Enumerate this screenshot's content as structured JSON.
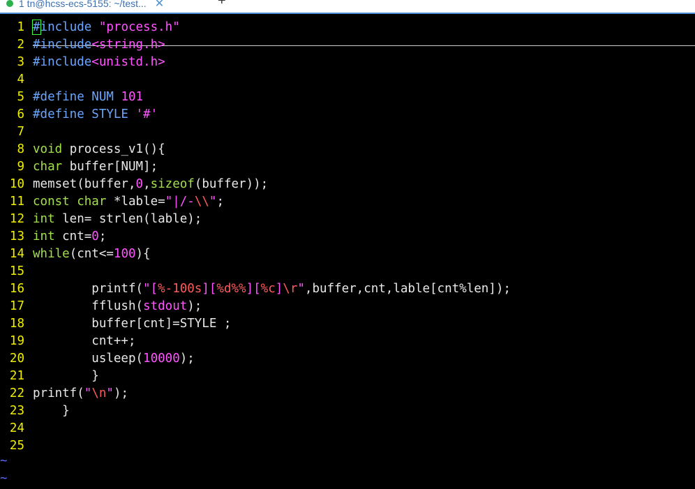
{
  "tab": {
    "title": "1 tn@hcss-ecs-5155: ~/test...",
    "close": "✕",
    "new_tab": "+"
  },
  "editor": {
    "lines": [
      {
        "num": "1",
        "tokens": [
          {
            "t": "#",
            "c": "k-pre",
            "cursor": true
          },
          {
            "t": "include ",
            "c": "k-pre"
          },
          {
            "t": "\"process.h\"",
            "c": "k-str"
          }
        ]
      },
      {
        "num": "2",
        "tokens": [
          {
            "t": "#include",
            "c": "k-pre"
          },
          {
            "t": "<string.h>",
            "c": "k-str"
          }
        ]
      },
      {
        "num": "3",
        "tokens": [
          {
            "t": "#include",
            "c": "k-pre"
          },
          {
            "t": "<unistd.h>",
            "c": "k-str"
          }
        ]
      },
      {
        "num": "4",
        "tokens": []
      },
      {
        "num": "5",
        "tokens": [
          {
            "t": "#define NUM ",
            "c": "k-pre"
          },
          {
            "t": "101",
            "c": "k-num"
          }
        ]
      },
      {
        "num": "6",
        "tokens": [
          {
            "t": "#define STYLE ",
            "c": "k-pre"
          },
          {
            "t": "'#'",
            "c": "k-str"
          }
        ]
      },
      {
        "num": "7",
        "tokens": []
      },
      {
        "num": "8",
        "tokens": [
          {
            "t": "void",
            "c": "k-type"
          },
          {
            "t": " process_v1(){",
            "c": "k-plain"
          }
        ]
      },
      {
        "num": "9",
        "tokens": [
          {
            "t": "char",
            "c": "k-type"
          },
          {
            "t": " buffer[NUM];",
            "c": "k-plain"
          }
        ]
      },
      {
        "num": "10",
        "tokens": [
          {
            "t": "memset(buffer,",
            "c": "k-plain"
          },
          {
            "t": "0",
            "c": "k-num"
          },
          {
            "t": ",",
            "c": "k-plain"
          },
          {
            "t": "sizeof",
            "c": "k-type"
          },
          {
            "t": "(buffer));",
            "c": "k-plain"
          }
        ]
      },
      {
        "num": "11",
        "tokens": [
          {
            "t": "const",
            "c": "k-type"
          },
          {
            "t": " ",
            "c": "k-plain"
          },
          {
            "t": "char",
            "c": "k-type"
          },
          {
            "t": " *lable=",
            "c": "k-plain"
          },
          {
            "t": "\"|/-",
            "c": "k-str"
          },
          {
            "t": "\\\\",
            "c": "k-esc"
          },
          {
            "t": "\"",
            "c": "k-str"
          },
          {
            "t": ";",
            "c": "k-plain"
          }
        ]
      },
      {
        "num": "12",
        "tokens": [
          {
            "t": "int",
            "c": "k-type"
          },
          {
            "t": " len= strlen(lable);",
            "c": "k-plain"
          }
        ]
      },
      {
        "num": "13",
        "tokens": [
          {
            "t": "int",
            "c": "k-type"
          },
          {
            "t": " cnt=",
            "c": "k-plain"
          },
          {
            "t": "0",
            "c": "k-num"
          },
          {
            "t": ";",
            "c": "k-plain"
          }
        ]
      },
      {
        "num": "14",
        "tokens": [
          {
            "t": "while",
            "c": "k-type"
          },
          {
            "t": "(cnt<=",
            "c": "k-plain"
          },
          {
            "t": "100",
            "c": "k-num"
          },
          {
            "t": "){",
            "c": "k-plain"
          }
        ]
      },
      {
        "num": "15",
        "tokens": []
      },
      {
        "num": "16",
        "tokens": [
          {
            "t": "        printf(",
            "c": "k-plain"
          },
          {
            "t": "\"[",
            "c": "k-str"
          },
          {
            "t": "%-100s",
            "c": "k-esc"
          },
          {
            "t": "][",
            "c": "k-str"
          },
          {
            "t": "%d%%",
            "c": "k-esc"
          },
          {
            "t": "][",
            "c": "k-str"
          },
          {
            "t": "%c",
            "c": "k-esc"
          },
          {
            "t": "]",
            "c": "k-str"
          },
          {
            "t": "\\r",
            "c": "k-esc"
          },
          {
            "t": "\"",
            "c": "k-str"
          },
          {
            "t": ",buffer,cnt,lable[cnt%len]);",
            "c": "k-plain"
          }
        ]
      },
      {
        "num": "17",
        "tokens": [
          {
            "t": "        fflush(",
            "c": "k-plain"
          },
          {
            "t": "stdout",
            "c": "k-str"
          },
          {
            "t": ");",
            "c": "k-plain"
          }
        ]
      },
      {
        "num": "18",
        "tokens": [
          {
            "t": "        buffer[cnt]=STYLE ;",
            "c": "k-plain"
          }
        ]
      },
      {
        "num": "19",
        "tokens": [
          {
            "t": "        cnt++;",
            "c": "k-plain"
          }
        ]
      },
      {
        "num": "20",
        "tokens": [
          {
            "t": "        usleep(",
            "c": "k-plain"
          },
          {
            "t": "10000",
            "c": "k-num"
          },
          {
            "t": ");",
            "c": "k-plain"
          }
        ]
      },
      {
        "num": "21",
        "tokens": [
          {
            "t": "        }",
            "c": "k-plain"
          }
        ]
      },
      {
        "num": "22",
        "tokens": [
          {
            "t": "printf(",
            "c": "k-plain"
          },
          {
            "t": "\"",
            "c": "k-str"
          },
          {
            "t": "\\n",
            "c": "k-esc"
          },
          {
            "t": "\"",
            "c": "k-str"
          },
          {
            "t": ");",
            "c": "k-plain"
          }
        ]
      },
      {
        "num": "23",
        "tokens": [
          {
            "t": "    }",
            "c": "k-plain"
          }
        ]
      },
      {
        "num": "24",
        "tokens": []
      },
      {
        "num": "25",
        "tokens": []
      }
    ],
    "tildes": [
      "~",
      "~"
    ]
  }
}
